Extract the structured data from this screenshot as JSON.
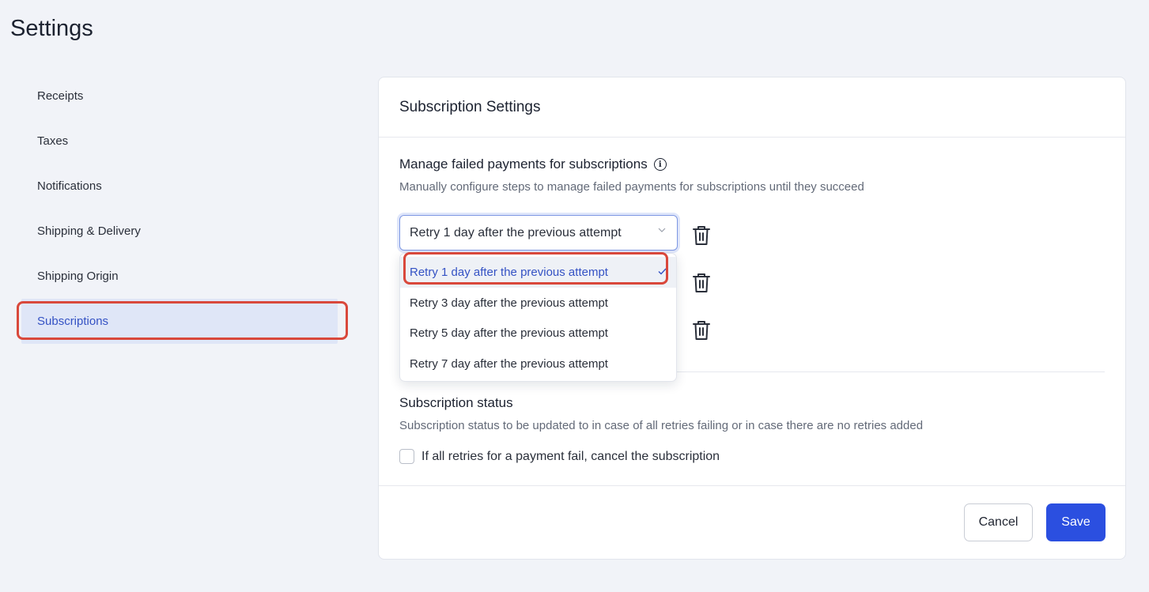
{
  "page": {
    "title": "Settings"
  },
  "sidebar": {
    "items": [
      {
        "label": "Receipts"
      },
      {
        "label": "Taxes"
      },
      {
        "label": "Notifications"
      },
      {
        "label": "Shipping & Delivery"
      },
      {
        "label": "Shipping Origin"
      },
      {
        "label": "Subscriptions"
      }
    ],
    "active": "Subscriptions"
  },
  "card": {
    "title": "Subscription Settings",
    "failed_payments": {
      "title": "Manage failed payments for subscriptions",
      "description": "Manually configure steps to manage failed payments for subscriptions until they succeed",
      "selected_value": "Retry 1 day after the previous attempt",
      "options": [
        "Retry 1 day after the previous attempt",
        "Retry 3 day after the previous attempt",
        "Retry 5 day after the previous attempt",
        "Retry 7 day after the previous attempt"
      ]
    },
    "status": {
      "title": "Subscription status",
      "description": "Subscription status to be updated to in case of all retries failing or in case there are no retries added",
      "checkbox_label": "If all retries for a payment fail, cancel the subscription",
      "checked": false
    },
    "buttons": {
      "cancel": "Cancel",
      "save": "Save"
    }
  },
  "icons": {
    "info": "info-icon",
    "chevron": "chevron-down-icon",
    "trash": "trash-icon",
    "check": "check-icon"
  },
  "colors": {
    "accent": "#2b4fe0",
    "active_text": "#3452c4",
    "active_bg": "#dfe6f7",
    "highlight": "#d9483b"
  }
}
